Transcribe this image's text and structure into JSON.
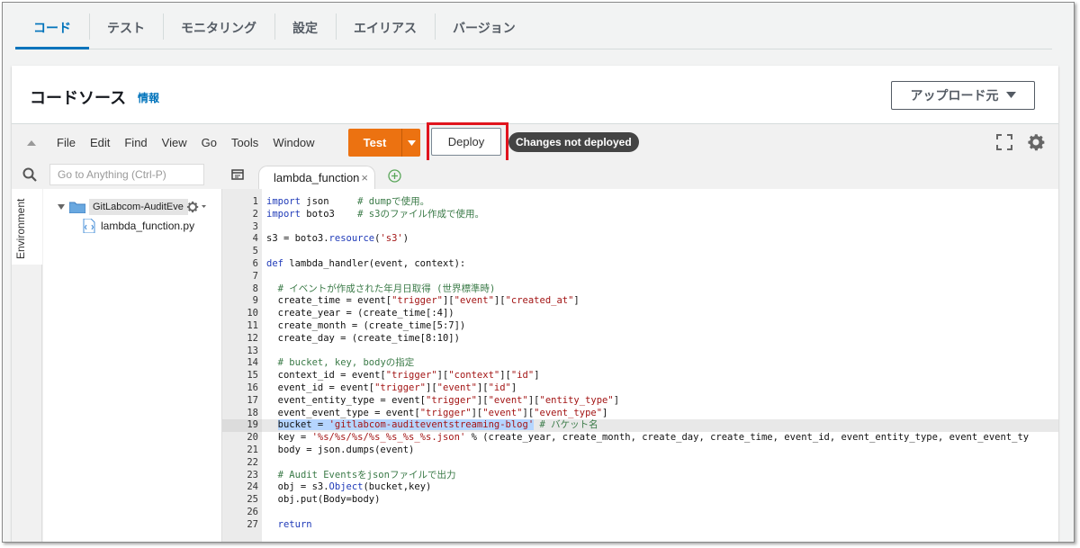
{
  "top_tabs": [
    {
      "label": "コード",
      "active": true
    },
    {
      "label": "テスト",
      "active": false
    },
    {
      "label": "モニタリング",
      "active": false
    },
    {
      "label": "設定",
      "active": false
    },
    {
      "label": "エイリアス",
      "active": false
    },
    {
      "label": "バージョン",
      "active": false
    }
  ],
  "panel": {
    "title": "コードソース",
    "info_link": "情報",
    "upload_button": "アップロード元"
  },
  "menu": {
    "items": [
      "File",
      "Edit",
      "Find",
      "View",
      "Go",
      "Tools",
      "Window"
    ],
    "test_button": "Test",
    "deploy_button": "Deploy",
    "status_badge": "Changes not deployed"
  },
  "sidebar": {
    "search_placeholder": "Go to Anything (Ctrl-P)",
    "environment_tab": "Environment",
    "folder_name": "GitLabcom-AuditEve",
    "file_name": "lambda_function.py"
  },
  "editor": {
    "tab_label": "lambda_function",
    "highlighted_line": 19,
    "lines": [
      {
        "n": "1",
        "text": "import json     # dumpで使用。"
      },
      {
        "n": "2",
        "text": "import boto3    # s3のファイル作成で使用。"
      },
      {
        "n": "3",
        "text": ""
      },
      {
        "n": "4",
        "text": "s3 = boto3.resource('s3')"
      },
      {
        "n": "5",
        "text": ""
      },
      {
        "n": "6",
        "text": "def lambda_handler(event, context):"
      },
      {
        "n": "7",
        "text": ""
      },
      {
        "n": "8",
        "text": "  # イベントが作成された年月日取得 (世界標準時)"
      },
      {
        "n": "9",
        "text": "  create_time = event[\"trigger\"][\"event\"][\"created_at\"]"
      },
      {
        "n": "10",
        "text": "  create_year = (create_time[:4])"
      },
      {
        "n": "11",
        "text": "  create_month = (create_time[5:7])"
      },
      {
        "n": "12",
        "text": "  create_day = (create_time[8:10])"
      },
      {
        "n": "13",
        "text": ""
      },
      {
        "n": "14",
        "text": "  # bucket, key, bodyの指定"
      },
      {
        "n": "15",
        "text": "  context_id = event[\"trigger\"][\"context\"][\"id\"]"
      },
      {
        "n": "16",
        "text": "  event_id = event[\"trigger\"][\"event\"][\"id\"]"
      },
      {
        "n": "17",
        "text": "  event_entity_type = event[\"trigger\"][\"event\"][\"entity_type\"]"
      },
      {
        "n": "18",
        "text": "  event_event_type = event[\"trigger\"][\"event\"][\"event_type\"]"
      },
      {
        "n": "19",
        "text": "  bucket = 'gitlabcom-auditeventstreaming-blog' # バケット名"
      },
      {
        "n": "20",
        "text": "  key = '%s/%s/%s/%s_%s_%s_%s.json' % (create_year, create_month, create_day, create_time, event_id, event_entity_type, event_event_ty"
      },
      {
        "n": "21",
        "text": "  body = json.dumps(event)"
      },
      {
        "n": "22",
        "text": ""
      },
      {
        "n": "23",
        "text": "  # Audit Eventsをjsonファイルで出力"
      },
      {
        "n": "24",
        "text": "  obj = s3.Object(bucket,key)"
      },
      {
        "n": "25",
        "text": "  obj.put(Body=body)"
      },
      {
        "n": "26",
        "text": ""
      },
      {
        "n": "27",
        "text": "  return"
      }
    ]
  }
}
